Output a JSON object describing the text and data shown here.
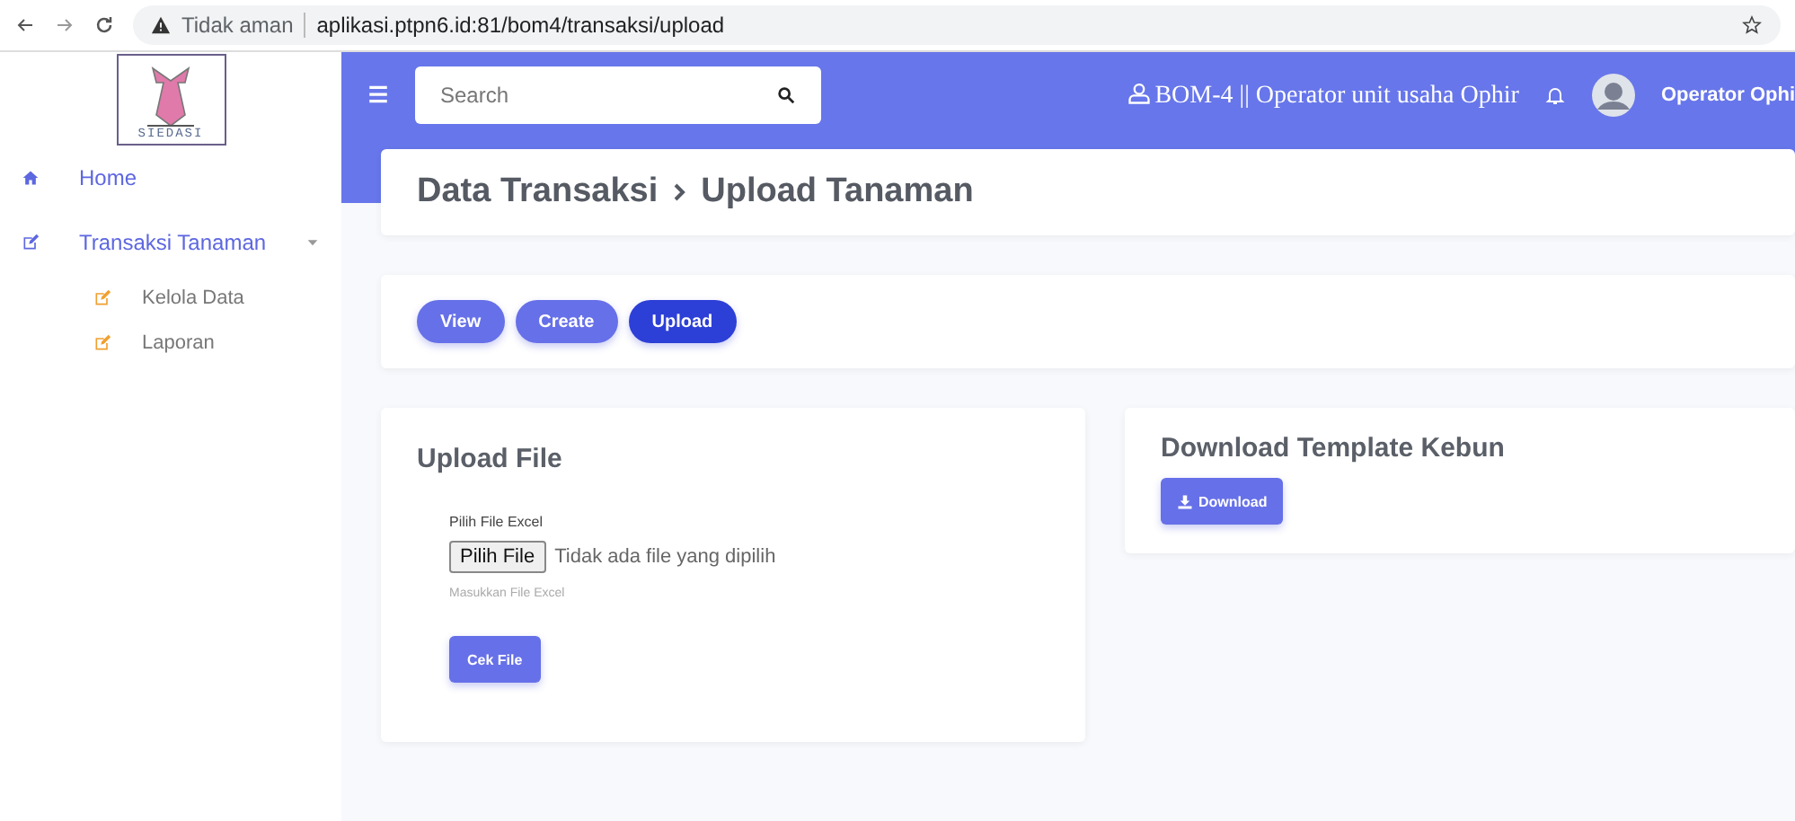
{
  "browser": {
    "security_label": "Tidak aman",
    "url": "aplikasi.ptpn6.id:81/bom4/transaksi/upload"
  },
  "sidebar": {
    "logo_text": "SIEDASI",
    "items": [
      {
        "label": "Home",
        "kind": "home"
      },
      {
        "label": "Transaksi Tanaman",
        "kind": "group",
        "expanded": true,
        "children": [
          {
            "label": "Kelola Data"
          },
          {
            "label": "Laporan"
          }
        ]
      }
    ]
  },
  "navbar": {
    "search": {
      "placeholder": "Search"
    },
    "role": "BOM-4 || Operator unit usaha Ophir",
    "user": "Operator Ophi"
  },
  "breadcrumb": [
    "Data Transaksi",
    "Upload Tanaman"
  ],
  "tabs": [
    {
      "label": "View",
      "selected": false
    },
    {
      "label": "Create",
      "selected": false
    },
    {
      "label": "Upload",
      "selected": true
    }
  ],
  "upload_card": {
    "title": "Upload File",
    "field_label": "Pilih File Excel",
    "file_button": "Pilih File",
    "file_status": "Tidak ada file yang dipilih",
    "help": "Masukkan File Excel",
    "submit": "Cek File"
  },
  "download_card": {
    "title": "Download Template Kebun",
    "button": "Download"
  }
}
